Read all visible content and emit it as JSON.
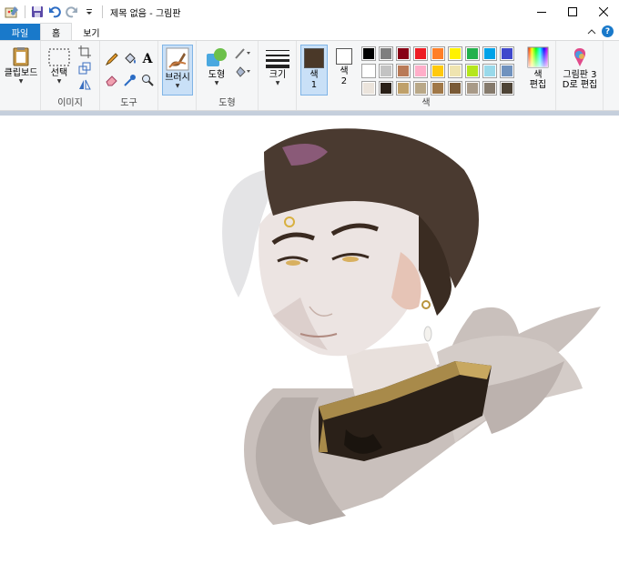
{
  "window": {
    "title": "제목 없음 - 그림판",
    "controls": {
      "minimize": "minimize",
      "maximize": "maximize",
      "close": "close"
    }
  },
  "tabs": [
    {
      "label": "파일",
      "active": false
    },
    {
      "label": "홈",
      "active": true
    },
    {
      "label": "보기",
      "active": false
    }
  ],
  "ribbon": {
    "clipboard": {
      "label": "클립보드"
    },
    "image": {
      "select_label": "선택",
      "group_label": "이미지"
    },
    "tools": {
      "group_label": "도구",
      "text_glyph": "A"
    },
    "brushes": {
      "label": "브러시"
    },
    "shapes": {
      "label": "도형",
      "group_label": "도형"
    },
    "size": {
      "label": "크기"
    },
    "color1": {
      "label_line1": "색",
      "label_line2": "1",
      "value": "#4a3828"
    },
    "color2": {
      "label_line1": "색",
      "label_line2": "2",
      "value": "#ffffff"
    },
    "colors": {
      "group_label": "색",
      "palette": [
        "#000000",
        "#7f7f7f",
        "#880015",
        "#ed1c24",
        "#ff7f27",
        "#fff200",
        "#22b14c",
        "#00a2e8",
        "#3f48cc",
        "#a349a4",
        "#ffffff",
        "#c3c3c3",
        "#b97a57",
        "#ffaec9",
        "#ffc90e",
        "#efe4b0",
        "#b5e61d",
        "#99d9ea",
        "#7092be",
        "#c8bfe7",
        "#ebe4dc",
        "#2a2018",
        "#bfa06a",
        "#b9a888",
        "#a07848",
        "#7a5a36",
        "#a89a88",
        "#857a6c",
        "#4e4436",
        "#5a4626"
      ]
    },
    "edit_colors": {
      "label_line1": "색",
      "label_line2": "편집"
    },
    "paint3d": {
      "label_line1": "그림판 3",
      "label_line2": "D로 편집"
    }
  }
}
